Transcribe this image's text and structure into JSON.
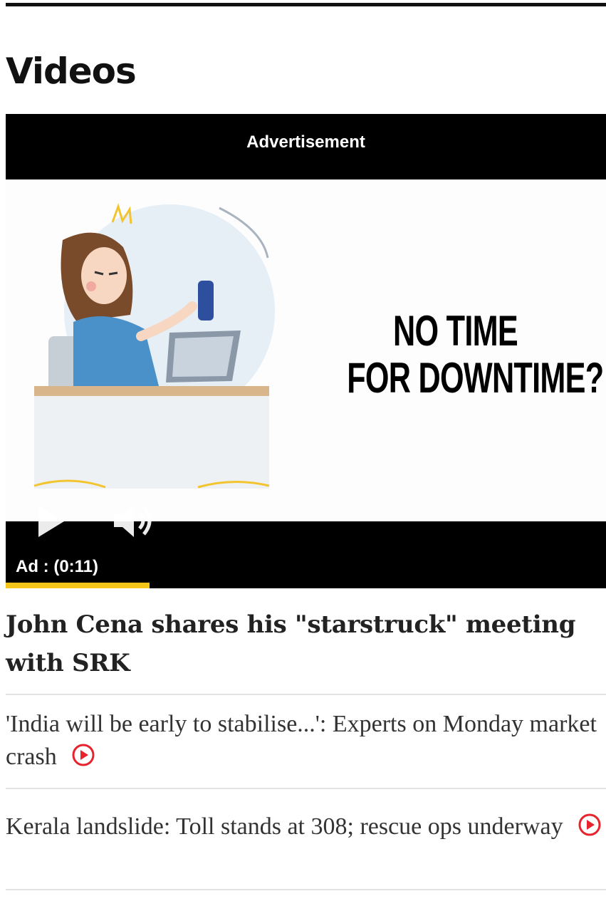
{
  "section": {
    "title": "Videos"
  },
  "ad": {
    "header_label": "Advertisement",
    "tagline_line1": "NO TIME",
    "tagline_line2": "FOR DOWNTIME?",
    "countdown": "Ad : (0:11)",
    "progress_fraction": 0.24,
    "progress_color": "#f5c518"
  },
  "icons": {
    "play": "play-icon",
    "volume": "volume-icon",
    "video_indicator": "play-circle-icon",
    "video_indicator_color": "#e8232e"
  },
  "stories": {
    "featured": {
      "title": "John Cena shares his \"starstruck\" meeting with SRK"
    },
    "items": [
      {
        "text": "'India will be early to stabilise...': Experts on Monday market crash"
      },
      {
        "text": "Kerala landslide: Toll stands at 308; rescue ops underway"
      }
    ]
  }
}
